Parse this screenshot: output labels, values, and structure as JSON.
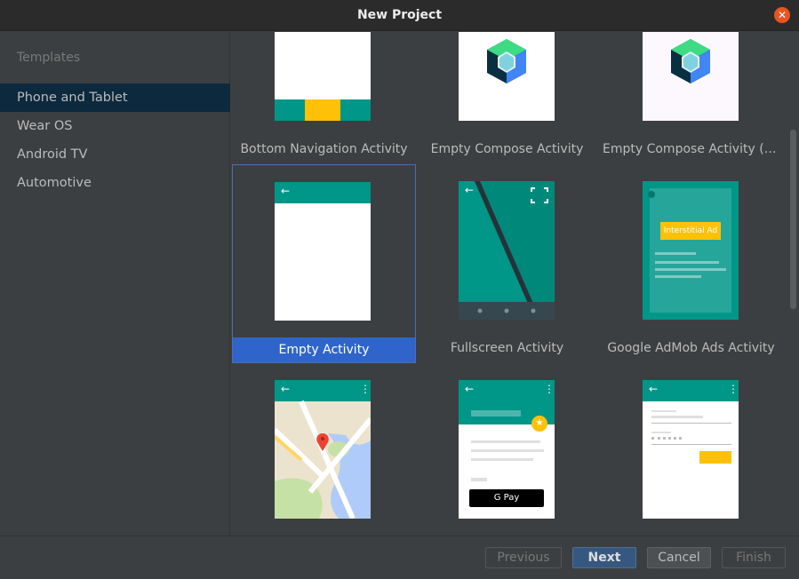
{
  "window": {
    "title": "New Project"
  },
  "sidebar": {
    "heading": "Templates",
    "items": [
      {
        "label": "Phone and Tablet",
        "selected": true
      },
      {
        "label": "Wear OS"
      },
      {
        "label": "Android TV"
      },
      {
        "label": "Automotive"
      }
    ]
  },
  "templates": [
    {
      "label": "Bottom Navigation Activity"
    },
    {
      "label": "Empty Compose Activity"
    },
    {
      "label": "Empty Compose Activity (Ma..."
    },
    {
      "label": "Empty Activity",
      "selected": true
    },
    {
      "label": "Fullscreen Activity"
    },
    {
      "label": "Google AdMob Ads Activity",
      "badge": "Interstitial Ad"
    },
    {
      "label": ""
    },
    {
      "label": "",
      "pay_label": "G Pay"
    },
    {
      "label": ""
    }
  ],
  "buttons": {
    "previous": "Previous",
    "next": "Next",
    "cancel": "Cancel",
    "finish": "Finish"
  },
  "colors": {
    "teal": "#009688",
    "dark_teal": "#00796b",
    "amber": "#ffc107",
    "selection": "#2f65ca"
  },
  "icons": {
    "back": "←",
    "menu": "⋮",
    "close": "✕",
    "star": "★",
    "fullscreen": "⛶"
  }
}
